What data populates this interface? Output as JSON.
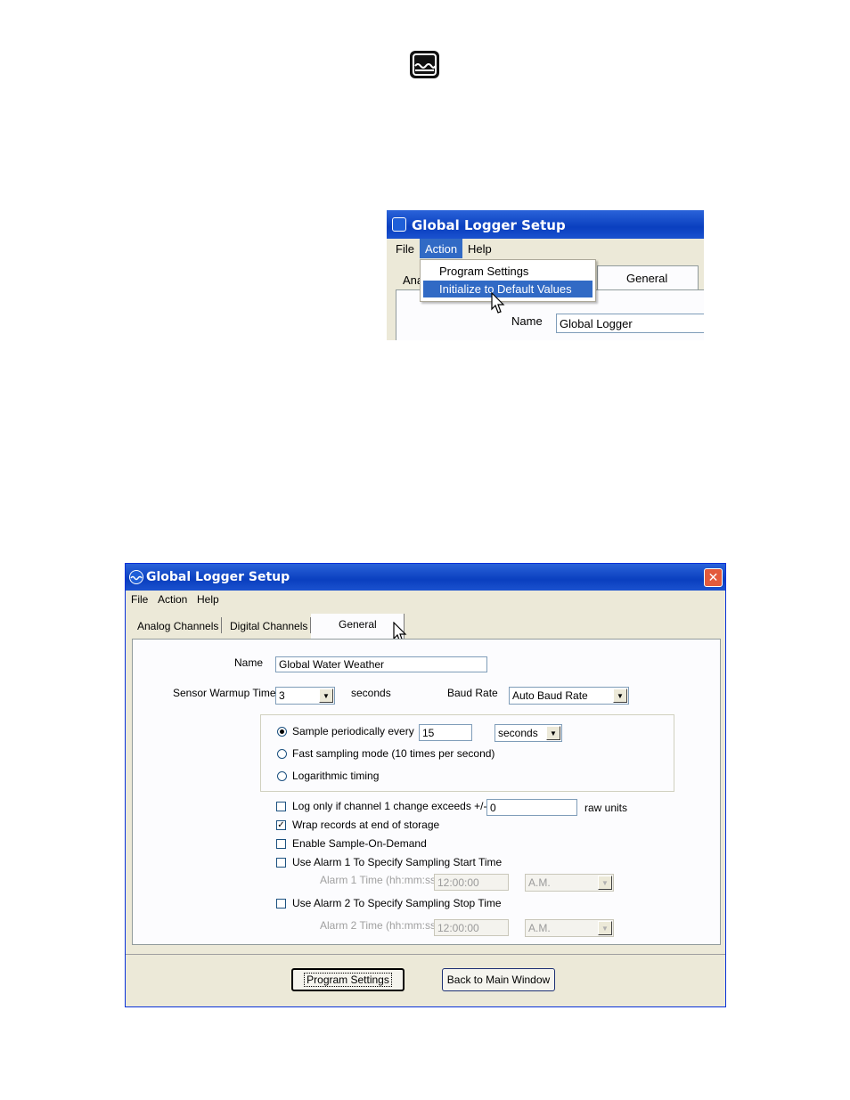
{
  "top_icon": {
    "icon": "water-wave-icon"
  },
  "snippet": {
    "title": "Global Logger Setup",
    "menu": [
      "File",
      "Action",
      "Help"
    ],
    "dropdown_items": [
      "Program Settings",
      "Initialize to Default Values"
    ],
    "tab_partial": "Ana",
    "tab_general": "General",
    "name_label": "Name",
    "name_value": "Global Logger"
  },
  "window": {
    "title": "Global Logger Setup",
    "close_icon": "close-icon",
    "menu": [
      "File",
      "Action",
      "Help"
    ],
    "tabs": [
      "Analog Channels",
      "Digital Channels",
      "General"
    ],
    "name_label": "Name",
    "name_value": "Global Water Weather",
    "warmup_label": "Sensor Warmup Time",
    "warmup_value": "3",
    "warmup_unit": "seconds",
    "baud_label": "Baud Rate",
    "baud_value": "Auto Baud Rate",
    "sampling": {
      "periodic_label": "Sample periodically every",
      "periodic_value": "15",
      "periodic_unit": "seconds",
      "fast_label": "Fast sampling mode (10 times per second)",
      "log_label": "Logarithmic timing"
    },
    "options": {
      "log_change_label": "Log only if channel 1 change exceeds +/-",
      "log_change_value": "0",
      "log_change_unit": "raw units",
      "wrap_label": "Wrap records at end of storage",
      "sod_label": "Enable Sample-On-Demand",
      "alarm1_label": "Use Alarm 1 To Specify Sampling Start Time",
      "alarm1_time_label": "Alarm 1 Time (hh:mm:ss)",
      "alarm1_time_value": "12:00:00",
      "alarm1_ampm": "A.M.",
      "alarm2_label": "Use Alarm 2 To Specify Sampling Stop Time",
      "alarm2_time_label": "Alarm 2 Time (hh:mm:ss)",
      "alarm2_time_value": "12:00:00",
      "alarm2_ampm": "A.M."
    },
    "buttons": {
      "program": "Program Settings",
      "back": "Back to Main Window"
    }
  }
}
